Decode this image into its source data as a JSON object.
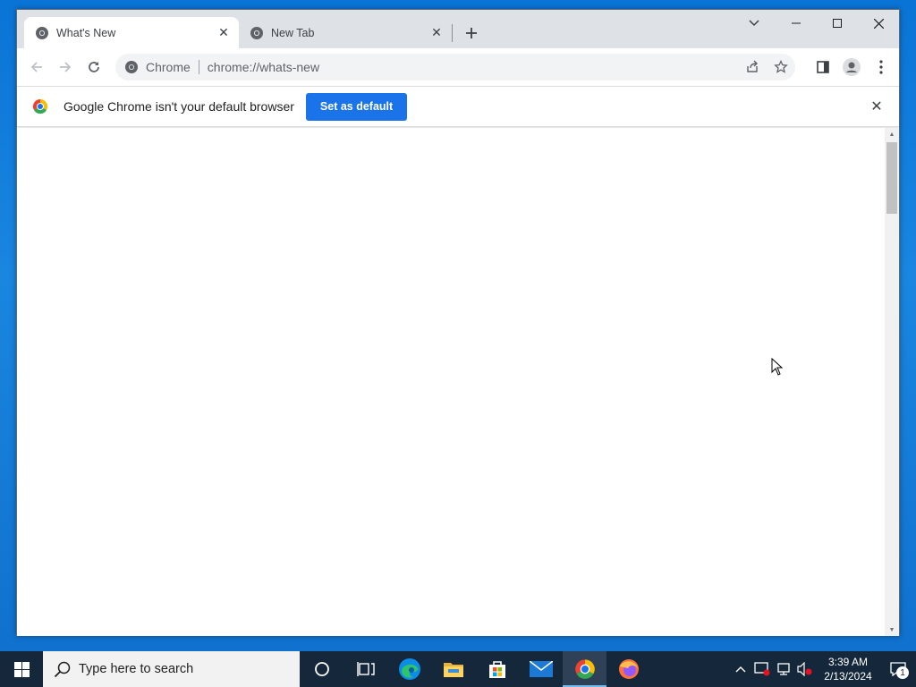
{
  "browser": {
    "tabs": [
      {
        "title": "What's New",
        "active": true
      },
      {
        "title": "New Tab",
        "active": false
      }
    ],
    "omnibox": {
      "site_name": "Chrome",
      "url": "chrome://whats-new"
    },
    "infobar": {
      "message": "Google Chrome isn't your default browser",
      "button_label": "Set as default"
    }
  },
  "taskbar": {
    "search_placeholder": "Type here to search",
    "pinned": [
      "cortana",
      "task-view",
      "edge",
      "file-explorer",
      "microsoft-store",
      "mail",
      "chrome",
      "firefox"
    ],
    "clock": {
      "time": "3:39 AM",
      "date": "2/13/2024"
    },
    "notification_count": "1"
  },
  "colors": {
    "accent_blue": "#1a73e8",
    "taskbar_bg": "#15283b",
    "tabstrip_bg": "#dee1e6"
  }
}
